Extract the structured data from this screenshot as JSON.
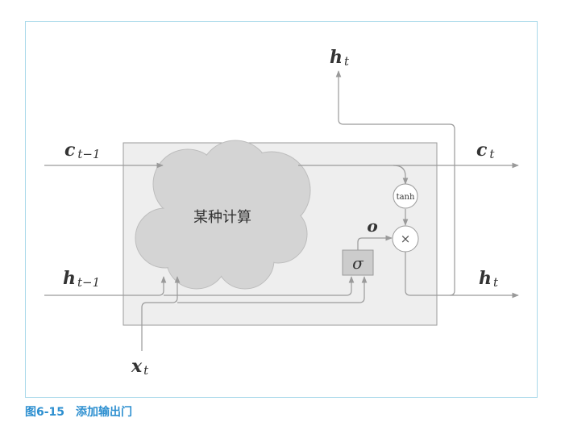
{
  "figure": {
    "caption_number": "图6-15",
    "caption_title": "添加输出门"
  },
  "diagram": {
    "cloud_label": "某种计算",
    "gate_symbol": "σ",
    "tanh_label": "tanh",
    "multiply_symbol": "×",
    "output_gate_label": "o",
    "labels": {
      "c_prev": {
        "main": "c",
        "sub": "t−1"
      },
      "c_next": {
        "main": "c",
        "sub": "t"
      },
      "h_prev": {
        "main": "h",
        "sub": "t−1"
      },
      "h_out_top": {
        "main": "h",
        "sub": "t"
      },
      "h_out_right": {
        "main": "h",
        "sub": "t"
      },
      "x_in": {
        "main": "x",
        "sub": "t"
      }
    },
    "colors": {
      "frame_border": "#a9d9ea",
      "box_fill": "#eeeeee",
      "cloud_fill": "#d4d4d4",
      "gate_fill": "#cccccc",
      "line": "#9a9a9a",
      "caption": "#2d8fd0"
    }
  }
}
